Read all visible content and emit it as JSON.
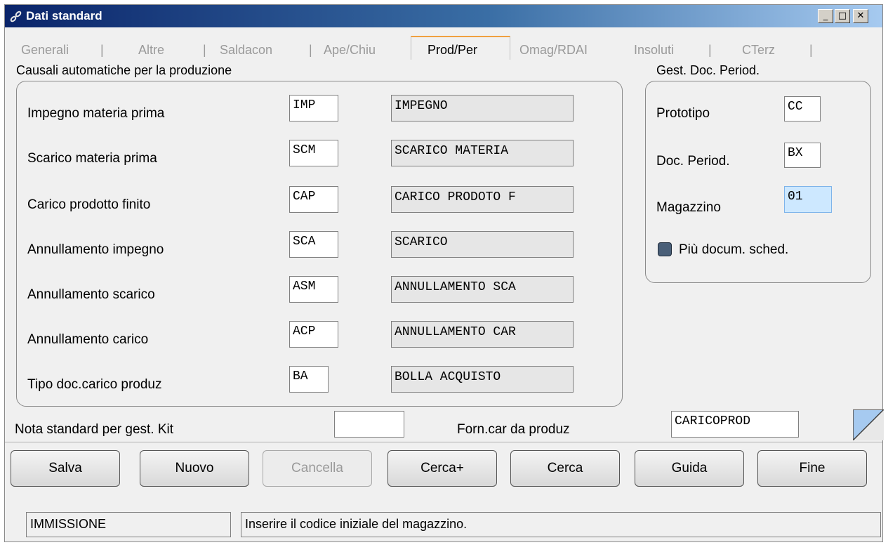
{
  "window": {
    "title": "Dati standard",
    "controls": {
      "minimize": "_",
      "maximize": "□",
      "close": "✕"
    }
  },
  "tabs": [
    {
      "label": "Generali",
      "active": false
    },
    {
      "label": "Altre",
      "active": false
    },
    {
      "label": "Saldacon",
      "active": false
    },
    {
      "label": "Ape/Chiu",
      "active": false
    },
    {
      "label": "Prod/Per",
      "active": true
    },
    {
      "label": "Omag/RDAI",
      "active": false
    },
    {
      "label": "Insoluti",
      "active": false
    },
    {
      "label": "CTerz",
      "active": false
    }
  ],
  "tab_separator": "|",
  "causali": {
    "section_title": "Causali automatiche per la produzione",
    "rows": [
      {
        "label": "Impegno materia prima",
        "code": "IMP",
        "desc": "IMPEGNO"
      },
      {
        "label": "Scarico materia prima",
        "code": "SCM",
        "desc": "SCARICO MATERIA"
      },
      {
        "label": "Carico prodotto finito",
        "code": "CAP",
        "desc": "CARICO PRODOTO F"
      },
      {
        "label": "Annullamento impegno",
        "code": "SCA",
        "desc": "SCARICO"
      },
      {
        "label": "Annullamento scarico",
        "code": "ASM",
        "desc": "ANNULLAMENTO SCA"
      },
      {
        "label": "Annullamento carico",
        "code": "ACP",
        "desc": "ANNULLAMENTO CAR"
      },
      {
        "label": "Tipo doc.carico produz",
        "code": "BA",
        "desc": "BOLLA ACQUISTO"
      }
    ]
  },
  "gest": {
    "section_title": "Gest. Doc. Period.",
    "prototipo_label": "Prototipo",
    "prototipo_value": "CC",
    "doc_period_label": "Doc. Period.",
    "doc_period_value": "BX",
    "magazzino_label": "Magazzino",
    "magazzino_value": "01",
    "piu_docum_label": "Più docum. sched."
  },
  "bottom": {
    "nota_label": "Nota standard per gest. Kit",
    "nota_value": "",
    "forn_label": "Forn.car da produz",
    "forn_value": "CARICOPROD"
  },
  "buttons": {
    "salva": "Salva",
    "nuovo": "Nuovo",
    "cancella": "Cancella",
    "cerca_plus": "Cerca+",
    "cerca": "Cerca",
    "guida": "Guida",
    "fine": "Fine"
  },
  "status": {
    "mode": "IMMISSIONE",
    "message": "Inserire il codice iniziale del magazzino."
  },
  "colors": {
    "title_gradient_start": "#0a246a",
    "active_tab_accent": "#f0a040",
    "focused_field_bg": "#cde8ff"
  }
}
